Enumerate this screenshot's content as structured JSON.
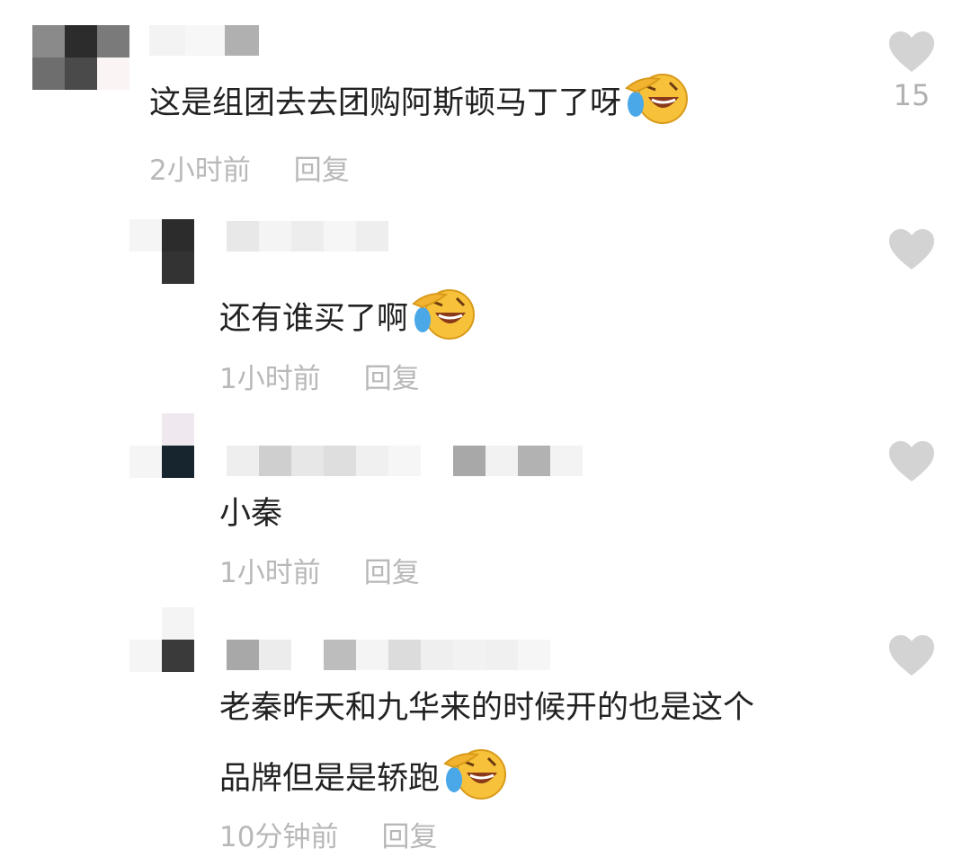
{
  "comments": [
    {
      "text": "这是组团去去团购阿斯顿马丁了呀",
      "time": "2小时前",
      "reply_label": "回复",
      "like_count": "15",
      "emoji_icon": "rofl-emoji-icon"
    },
    {
      "text": "还有谁买了啊",
      "time": "1小时前",
      "reply_label": "回复",
      "emoji_icon": "rofl-emoji-icon"
    },
    {
      "text": "小秦",
      "time": "1小时前",
      "reply_label": "回复"
    },
    {
      "text_line1": "老秦昨天和九华来的时候开的也是这个",
      "text_line2": "品牌但是是轿跑",
      "time": "10分钟前",
      "reply_label": "回复",
      "emoji_icon": "rofl-emoji-icon"
    }
  ],
  "colors": {
    "text": "#222222",
    "meta": "#b8b8b8",
    "like_icon": "#d3d3d3",
    "emoji_face": "#f7c23a"
  },
  "icons": [
    "heart-like-icon",
    "rofl-emoji-icon",
    "pixelated-avatar",
    "pixelated-username"
  ]
}
